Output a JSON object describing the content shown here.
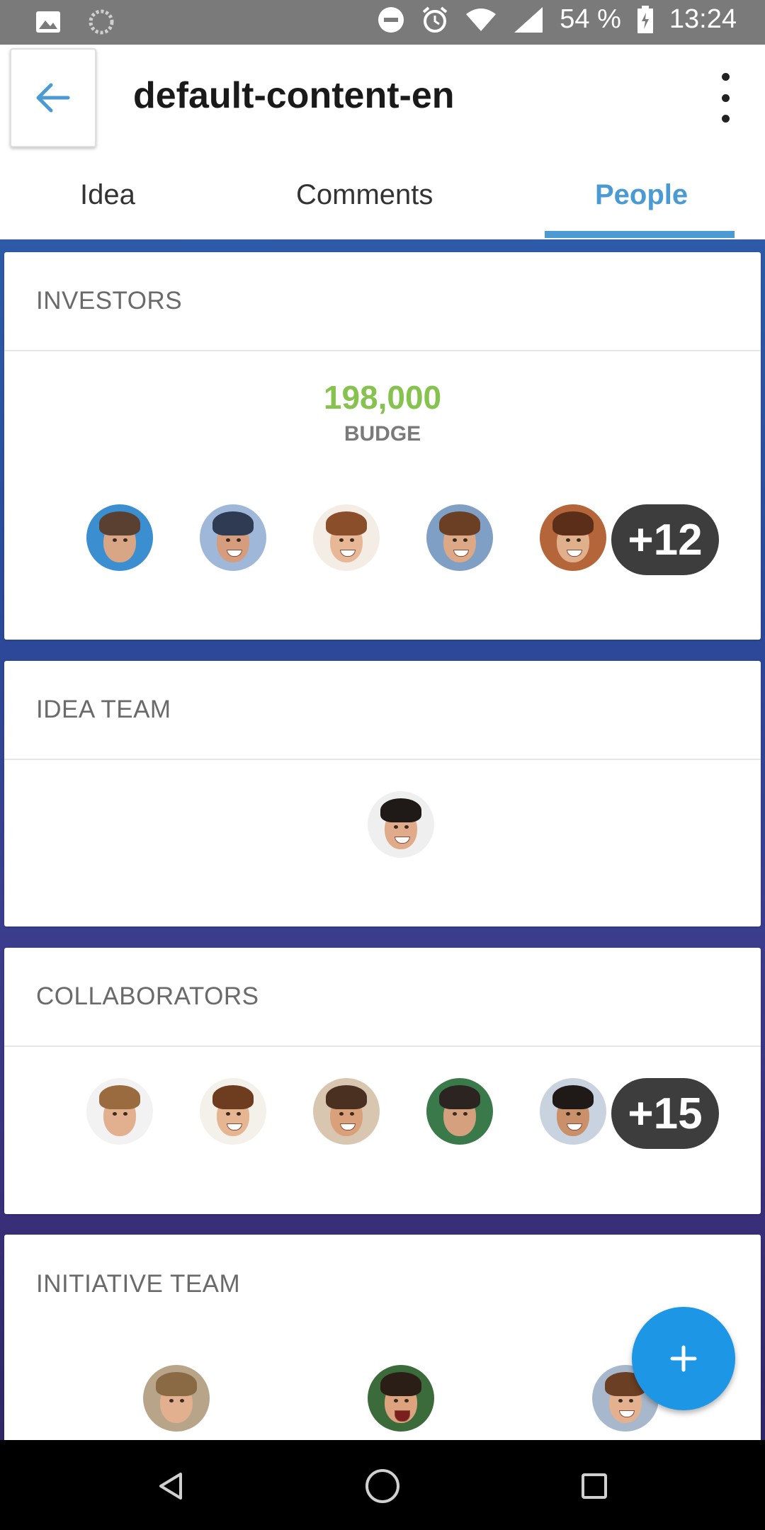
{
  "status_bar": {
    "battery": "54 %",
    "time": "13:24",
    "icons": [
      "image-icon",
      "loading-icon",
      "do-not-disturb-icon",
      "alarm-icon",
      "wifi-icon",
      "signal-icon",
      "battery-icon"
    ]
  },
  "app_bar": {
    "title": "default-content-en",
    "back_icon": "arrow-left-icon",
    "more_icon": "more-vertical-icon"
  },
  "tabs": [
    {
      "label": "Idea",
      "active": false
    },
    {
      "label": "Comments",
      "active": false
    },
    {
      "label": "People",
      "active": true
    }
  ],
  "accent_color": "#4a9ad4",
  "sections": {
    "investors": {
      "title": "INVESTORS",
      "budget_value": "198,000",
      "budget_label": "BUDGE",
      "avatars": [
        "investor-1",
        "investor-2",
        "investor-3",
        "investor-4",
        "investor-5"
      ],
      "more_count": "+12"
    },
    "idea_team": {
      "title": "IDEA TEAM",
      "avatars": [
        "idea-team-member-1"
      ]
    },
    "collaborators": {
      "title": "COLLABORATORS",
      "avatars": [
        "collaborator-1",
        "collaborator-2",
        "collaborator-3",
        "collaborator-4",
        "collaborator-5"
      ],
      "more_count": "+15"
    },
    "initiative_team": {
      "title": "INITIATIVE TEAM",
      "avatars": [
        "initiative-member-1",
        "initiative-member-2",
        "initiative-member-3"
      ]
    }
  },
  "fab": {
    "icon": "plus-icon",
    "color": "#1e96e6"
  },
  "nav_bar": {
    "icons": [
      "back-triangle-icon",
      "home-circle-icon",
      "recents-square-icon"
    ]
  }
}
